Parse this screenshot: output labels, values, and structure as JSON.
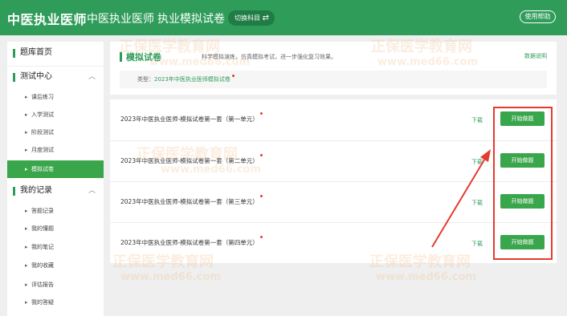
{
  "header": {
    "brand": "中医执业医师",
    "subject": "中医执业医师",
    "exam": "执业模拟试卷",
    "switch_label": "切换科目",
    "help_label": "使用帮助"
  },
  "sidebar": {
    "home": "题库首页",
    "test_center": "测试中心",
    "test_items": [
      "课后练习",
      "入学测试",
      "阶段测试",
      "月度测试",
      "模拟试卷"
    ],
    "records": "我的记录",
    "record_items": [
      "答题记录",
      "我的懂题",
      "我的笔记",
      "我的收藏",
      "评估报告",
      "我的答疑"
    ]
  },
  "panel": {
    "title": "模拟试卷",
    "description": "科学模拟演练，仿真模拟考试，进一步强化复习效果。",
    "link": "数据说明",
    "type_label": "类型：",
    "type_value": "2023年中医执业医师模拟试卷"
  },
  "exams": [
    {
      "title": "2023年中医执业医师-模拟试卷第一套（第一单元）",
      "download": "下载",
      "start": "开始做题"
    },
    {
      "title": "2023年中医执业医师-模拟试卷第一套（第二单元）",
      "download": "下载",
      "start": "开始做题"
    },
    {
      "title": "2023年中医执业医师-模拟试卷第一套（第三单元）",
      "download": "下载",
      "start": "开始做题"
    },
    {
      "title": "2023年中医执业医师-模拟试卷第一套（第四单元）",
      "download": "下载",
      "start": "开始做题"
    }
  ],
  "watermark": {
    "name": "正保医学教育网",
    "url": "www.med66.com"
  },
  "icons": {
    "switch": "swap-arrows-icon",
    "expand": "chevron-up-icon",
    "bullet": "triangle-right-icon"
  },
  "colors": {
    "brand_green": "#2f9c5a",
    "button_green": "#3aa64b",
    "annotation_red": "#e53b2e"
  }
}
